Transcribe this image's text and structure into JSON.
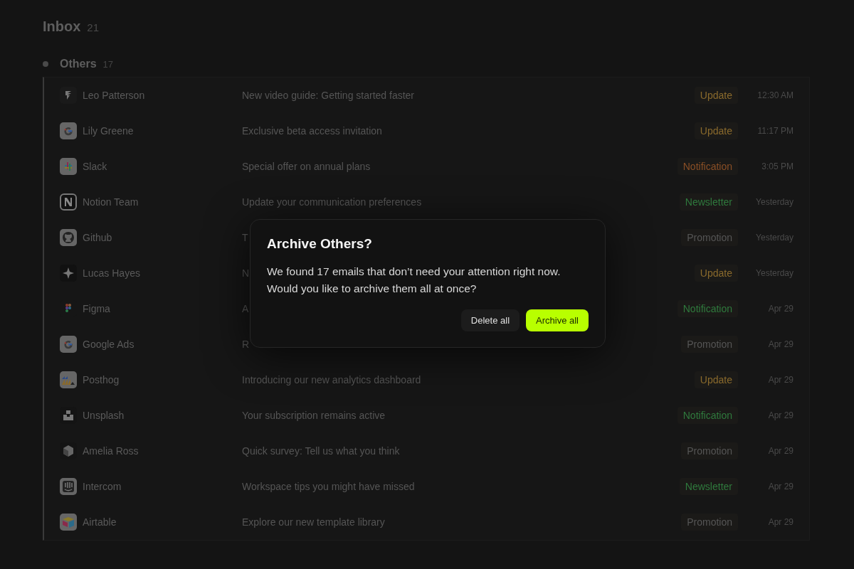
{
  "header": {
    "title": "Inbox",
    "count": "21"
  },
  "group": {
    "title": "Others",
    "count": "17",
    "expanded": true
  },
  "emails": [
    {
      "sender": "Leo Patterson",
      "subject": "New video guide: Getting started faster",
      "tag": "Update",
      "color": "#8a6a2c",
      "time": "12:30 AM"
    },
    {
      "sender": "Lily Greene",
      "subject": "Exclusive beta access invitation",
      "tag": "Update",
      "color": "#8a6a2c",
      "time": "11:17 PM"
    },
    {
      "sender": "Slack",
      "subject": "Special offer on annual plans",
      "tag": "Notification",
      "color": "#8a4f26",
      "time": "3:05 PM"
    },
    {
      "sender": "Notion Team",
      "subject": "Update your communication preferences",
      "tag": "Newsletter",
      "color": "#2f7a3d",
      "time": "Yesterday"
    },
    {
      "sender": "Github",
      "subject": "T",
      "tag": "Promotion",
      "color": "#555555",
      "time": "Yesterday"
    },
    {
      "sender": "Lucas Hayes",
      "subject": "N",
      "tag": "Update",
      "color": "#8a6a2c",
      "time": "Yesterday"
    },
    {
      "sender": "Figma",
      "subject": "A",
      "tag": "Notification",
      "color": "#2f7a3d",
      "time": "Apr 29"
    },
    {
      "sender": "Google Ads",
      "subject": "R",
      "tag": "Promotion",
      "color": "#555555",
      "time": "Apr 29"
    },
    {
      "sender": "Posthog",
      "subject": "Introducing our new analytics dashboard",
      "tag": "Update",
      "color": "#8a6a2c",
      "time": "Apr 29"
    },
    {
      "sender": "Unsplash",
      "subject": "Your subscription remains active",
      "tag": "Notification",
      "color": "#2f7a3d",
      "time": "Apr 29"
    },
    {
      "sender": "Amelia Ross",
      "subject": "Quick survey: Tell us what you think",
      "tag": "Promotion",
      "color": "#555555",
      "time": "Apr 29"
    },
    {
      "sender": "Intercom",
      "subject": "Workspace tips you might have missed",
      "tag": "Newsletter",
      "color": "#2f7a3d",
      "time": "Apr 29"
    },
    {
      "sender": "Airtable",
      "subject": "Explore our new template library",
      "tag": "Promotion",
      "color": "#555555",
      "time": "Apr 29"
    }
  ],
  "dialog": {
    "title": "Archive Others?",
    "message": "We found 17 emails that don’t need your attention right now. Would you like to archive them all at once?",
    "buttons": [
      {
        "label": "Delete all",
        "kind": "secondary"
      },
      {
        "label": "Archive all",
        "kind": "primary"
      }
    ]
  }
}
